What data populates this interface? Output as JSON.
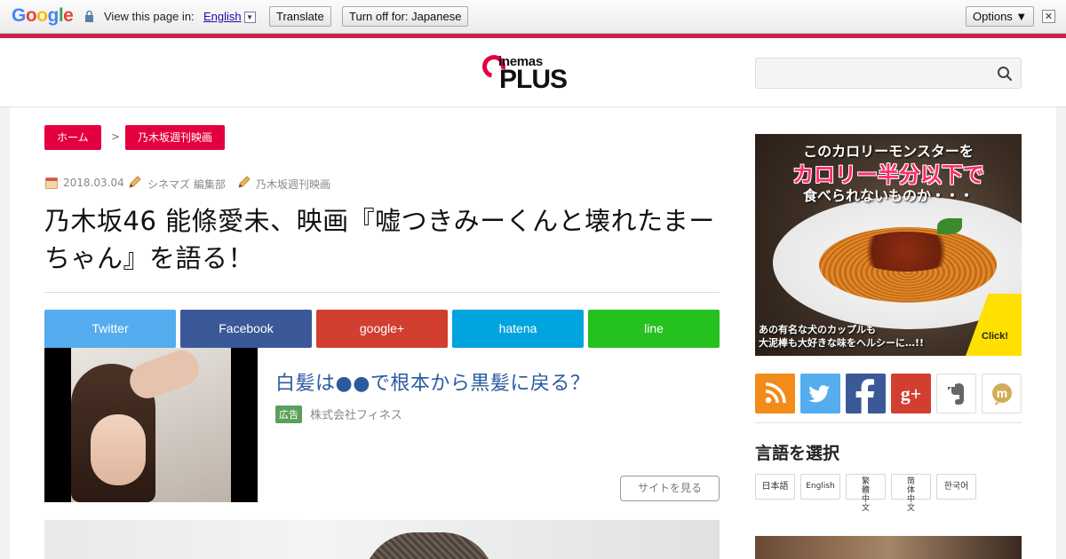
{
  "translate_bar": {
    "brand": [
      "G",
      "o",
      "o",
      "g",
      "l",
      "e"
    ],
    "brand_colors": [
      "#4285f4",
      "#ea4335",
      "#fbbc05",
      "#4285f4",
      "#34a853",
      "#ea4335"
    ],
    "prompt": "View this page in:",
    "language": "English",
    "translate_label": "Translate",
    "turn_off_label": "Turn off for: Japanese",
    "options_label": "Options ▼",
    "close_glyph": "✕"
  },
  "header": {
    "logo_small": "inemas",
    "logo_big": "PLUS",
    "search": {
      "placeholder": "",
      "value": ""
    }
  },
  "breadcrumb": {
    "home": "ホーム",
    "separator": ">",
    "category": "乃木坂週刊映画"
  },
  "article": {
    "date": "2018.03.04",
    "author": "シネマズ 編集部",
    "category": "乃木坂週刊映画",
    "title": "乃木坂46 能條愛未、映画『嘘つきみーくんと壊れたまーちゃん』を語る！"
  },
  "share_buttons": [
    {
      "label": "Twitter",
      "color": "#55acee"
    },
    {
      "label": "Facebook",
      "color": "#3b5998"
    },
    {
      "label": "google+",
      "color": "#d23e30"
    },
    {
      "label": "hatena",
      "color": "#00a4de"
    },
    {
      "label": "line",
      "color": "#25c11f"
    }
  ],
  "ad": {
    "title": "白髪は●●で根本から黒髪に戻る？",
    "badge": "広告",
    "sponsor": "株式会社フィネス",
    "cta": "サイトを見る"
  },
  "sidebar": {
    "banner": {
      "line1": "このカロリーモンスターを",
      "line2": "カロリー半分以下で",
      "line3": "食べられないものか・・・",
      "line4": "あの有名な犬のカップルも",
      "line5": "大泥棒も大好きな味をヘルシーに…!!",
      "click": "Click!"
    },
    "social": [
      {
        "name": "rss",
        "color": "#f28b1a"
      },
      {
        "name": "twitter",
        "color": "#55acee"
      },
      {
        "name": "facebook",
        "color": "#3b5998"
      },
      {
        "name": "google-plus",
        "color": "#d23e30"
      },
      {
        "name": "evernote",
        "color": "#ffffff"
      },
      {
        "name": "mixi",
        "color": "#ffffff"
      }
    ],
    "gplus_text": "g+",
    "mixi_text": "m",
    "lang_heading": "言語を選択",
    "languages": [
      {
        "label": "日本語"
      },
      {
        "label": "English"
      },
      {
        "label": "繁體中文"
      },
      {
        "label": "简体中文"
      },
      {
        "label": "한국어"
      }
    ]
  }
}
